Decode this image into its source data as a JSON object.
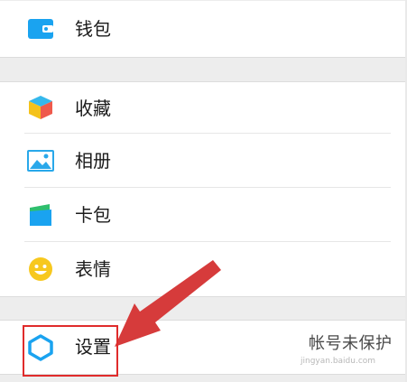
{
  "menu": {
    "wallet": {
      "label": "钱包",
      "icon": "wallet-icon"
    },
    "favorites": {
      "label": "收藏",
      "icon": "cube-icon"
    },
    "album": {
      "label": "相册",
      "icon": "picture-icon"
    },
    "card_pack": {
      "label": "卡包",
      "icon": "card-icon"
    },
    "stickers": {
      "label": "表情",
      "icon": "smiley-icon"
    },
    "settings": {
      "label": "设置",
      "icon": "gear-icon",
      "right_text": "帐号未保护"
    }
  },
  "watermark": "jingyan.baidu.com",
  "colors": {
    "wallet_blue": "#1aa3f0",
    "album_blue": "#29a8ea",
    "smiley_yellow": "#f7c81e",
    "highlight_red": "#e02b2b",
    "arrow_red": "#d63b3b"
  }
}
